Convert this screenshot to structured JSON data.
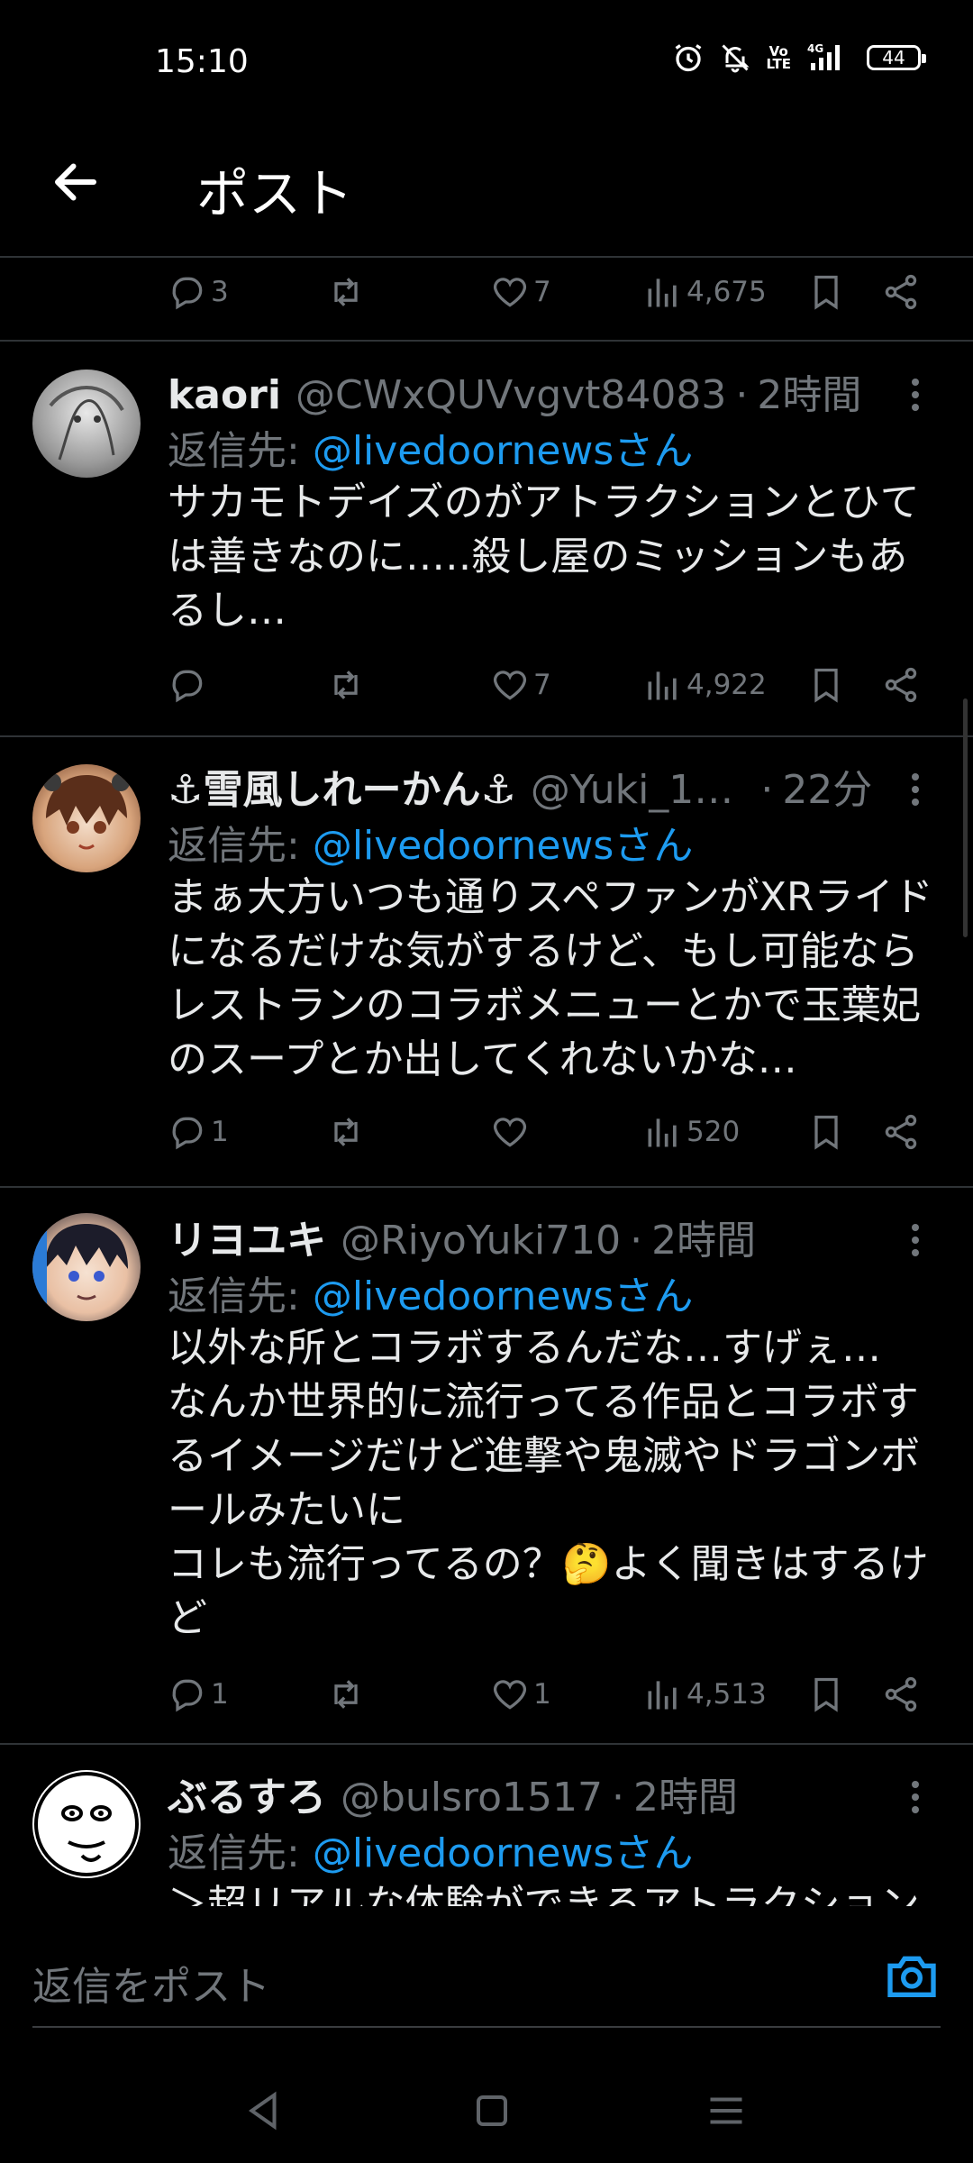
{
  "status_bar": {
    "time": "15:10",
    "volte": "Vo\nLTE",
    "network": "4G",
    "battery": "44"
  },
  "header": {
    "title": "ポスト",
    "back_icon": "arrow-left-icon"
  },
  "top_actions": {
    "replies": "3",
    "retweets": "",
    "likes": "7",
    "views": "4,675"
  },
  "tweets": [
    {
      "name": "kaori",
      "handle": "@CWxQUVvgvt84083",
      "sep": "·",
      "ago": "2時間",
      "reply_label": "返信先: ",
      "reply_to": "@livedoornewsさん",
      "text": "サカモトデイズのがアトラクションとひては善きなのに…‥殺し屋のミッションもあるし…",
      "replies": "",
      "likes": "7",
      "views": "4,922"
    },
    {
      "name": "⚓雪風しれーかん⚓",
      "handle": "@Yuki_1…",
      "sep": "·",
      "ago": "22分",
      "reply_label": "返信先: ",
      "reply_to": "@livedoornewsさん",
      "text": "まぁ大方いつも通りスペファンがXRライドになるだけな気がするけど、もし可能ならレストランのコラボメニューとかで玉葉妃のスープとか出してくれないかな…",
      "replies": "1",
      "likes": "",
      "views": "520"
    },
    {
      "name": "リヨユキ",
      "handle": "@RiyoYuki710",
      "sep": "·",
      "ago": "2時間",
      "reply_label": "返信先: ",
      "reply_to": "@livedoornewsさん",
      "text": "以外な所とコラボするんだな…すげぇ…\nなんか世界的に流行ってる作品とコラボするイメージだけど進撃や鬼滅やドラゴンボールみたいに\nコレも流行ってるの？🤔よく聞きはするけど",
      "replies": "1",
      "likes": "1",
      "views": "4,513"
    },
    {
      "name": "ぶるすろ",
      "handle": "@bulsro1517",
      "sep": "·",
      "ago": "2時間",
      "reply_label": "返信先: ",
      "reply_to": "@livedoornewsさん",
      "text": "＞超リアルな体験ができるアトラクション"
    }
  ],
  "compose": {
    "placeholder": "返信をポスト"
  },
  "colors": {
    "accent": "#1d9bf0",
    "muted": "#71767b",
    "text": "#e7e9ea",
    "bg": "#000000"
  }
}
